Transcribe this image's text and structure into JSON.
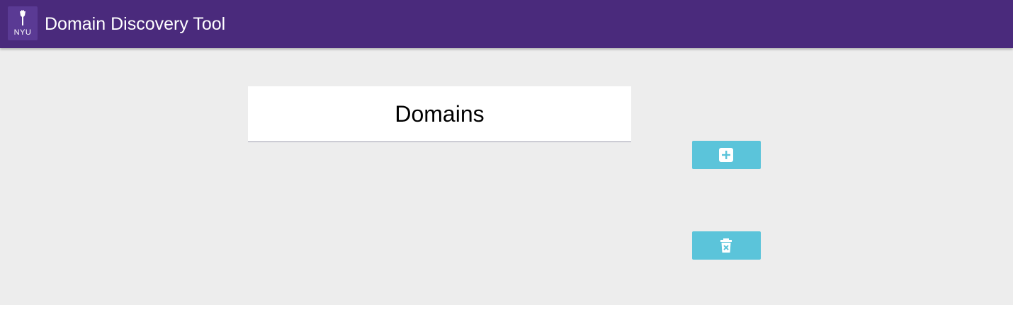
{
  "header": {
    "logo_text": "NYU",
    "title": "Domain Discovery Tool"
  },
  "panel": {
    "title": "Domains"
  },
  "actions": {
    "add_icon": "plus-square-icon",
    "delete_icon": "trash-icon"
  },
  "colors": {
    "header_bg": "#4a2a7c",
    "content_bg": "#ededed",
    "button_bg": "#5bc4da"
  }
}
